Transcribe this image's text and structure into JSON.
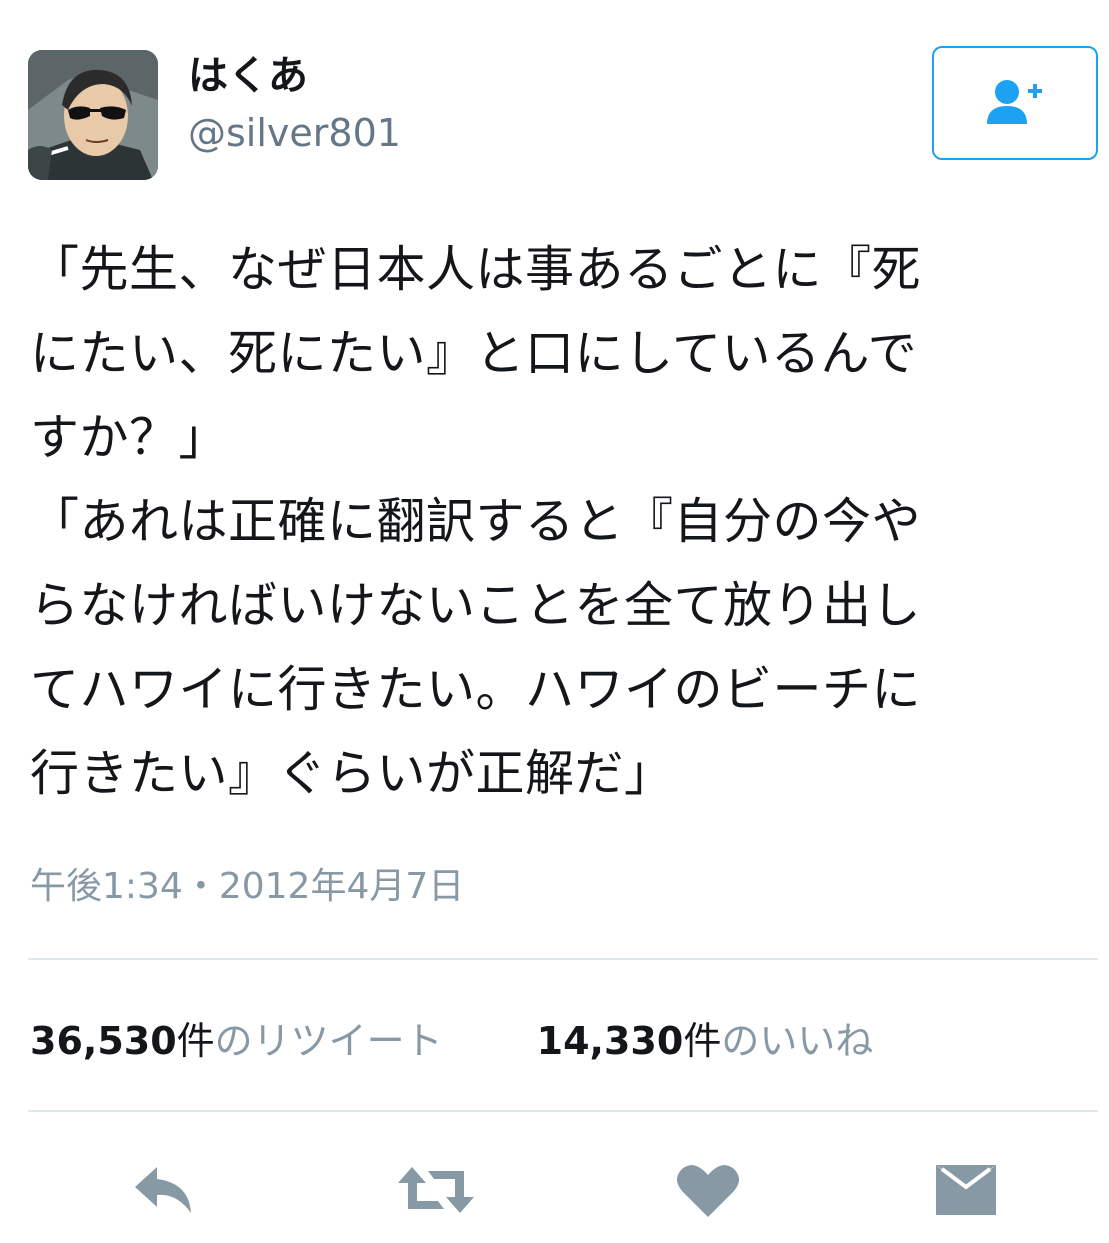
{
  "tweet": {
    "user": {
      "display_name": "はくあ",
      "handle": "@silver801",
      "avatar_icon": "avatar-image"
    },
    "follow_icon": "follow-user-icon",
    "text_lines": [
      "「先生、なぜ日本人は事あるごとに『死",
      "にたい、死にたい』と口にしているんで",
      "すか？」",
      "「あれは正確に翻訳すると『自分の今や",
      "らなければいけないことを全て放り出し",
      "てハワイに行きたい。ハワイのビーチに",
      "行きたい』ぐらいが正解だ」"
    ],
    "timestamp": "午後1:34・2012年4月7日",
    "stats": {
      "retweets": {
        "count": "36,530",
        "unit": "件",
        "label": "のリツイート"
      },
      "likes": {
        "count": "14,330",
        "unit": "件",
        "label": "のいいね"
      }
    },
    "actions": [
      {
        "name": "reply",
        "icon": "reply-icon"
      },
      {
        "name": "retweet",
        "icon": "retweet-icon"
      },
      {
        "name": "like",
        "icon": "heart-icon"
      },
      {
        "name": "direct-message",
        "icon": "envelope-icon"
      }
    ]
  },
  "colors": {
    "accent": "#1da1f2",
    "text": "#14171a",
    "muted": "#8899a6",
    "icon": "#8899a6",
    "divider": "#e1e8ed"
  }
}
